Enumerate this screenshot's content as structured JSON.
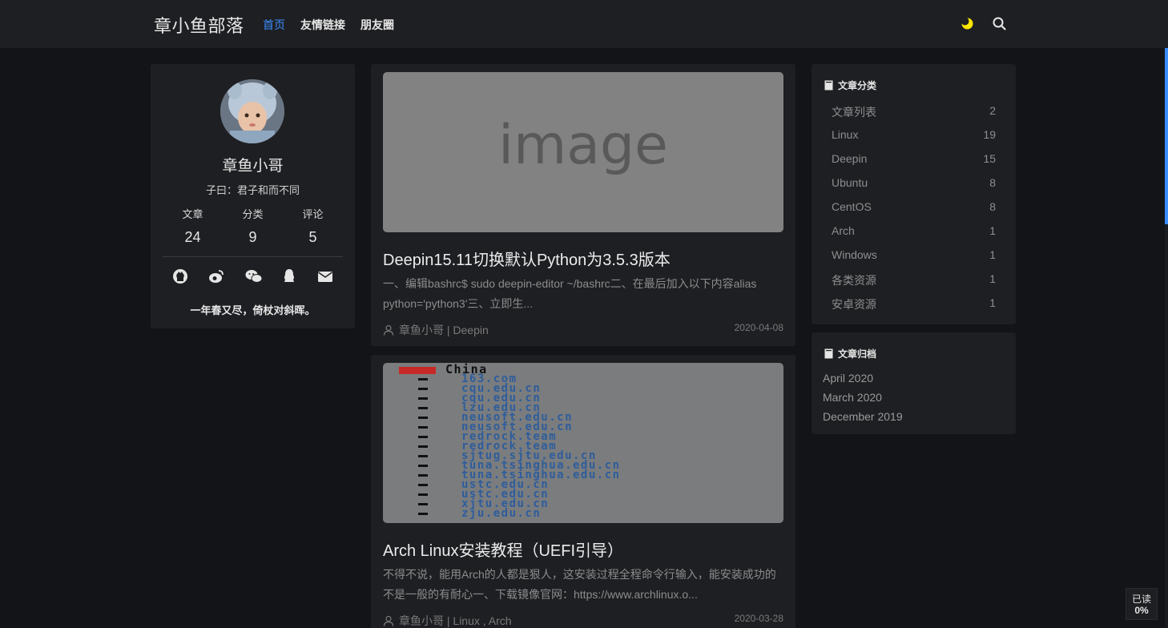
{
  "header": {
    "brand": "章小鱼部落",
    "nav": [
      {
        "label": "首页",
        "active": true
      },
      {
        "label": "友情链接",
        "active": false
      },
      {
        "label": "朋友圈",
        "active": false
      }
    ],
    "icons": [
      "moon-icon",
      "search-icon"
    ],
    "accent_color": "#3b8cff",
    "moon_color": "#ffe600"
  },
  "profile": {
    "name": "章鱼小哥",
    "motto": "子曰：君子和而不同",
    "stats": [
      {
        "label": "文章",
        "value": "24"
      },
      {
        "label": "分类",
        "value": "9"
      },
      {
        "label": "评论",
        "value": "5"
      }
    ],
    "socials": [
      "github-icon",
      "weibo-icon",
      "wechat-icon",
      "qq-icon",
      "email-icon"
    ],
    "quote": "一年春又尽，倚杖对斜晖。"
  },
  "posts": [
    {
      "cover_text": "image",
      "title": "Deepin15.11切换默认Python为3.5.3版本",
      "excerpt": "一、编辑bashrc$ sudo deepin-editor ~/bashrc二、在最后加入以下内容alias python='python3'三、立即生...",
      "meta": "章鱼小哥 | Deepin",
      "date": "2020-04-08"
    },
    {
      "cover_country": "China",
      "cover_mirrors": [
        "163.com",
        "cqu.edu.cn",
        "cqu.edu.cn",
        "lzu.edu.cn",
        "neusoft.edu.cn",
        "neusoft.edu.cn",
        "redrock.team",
        "redrock.team",
        "sjtug.sjtu.edu.cn",
        "tuna.tsinghua.edu.cn",
        "tuna.tsinghua.edu.cn",
        "ustc.edu.cn",
        "ustc.edu.cn",
        "xjtu.edu.cn",
        "zju.edu.cn"
      ],
      "title": "Arch Linux安装教程（UEFI引导）",
      "excerpt": "不得不说，能用Arch的人都是狠人，这安装过程全程命令行输入，能安装成功的不是一般的有耐心一、下载镜像官网：https://www.archlinux.o...",
      "meta": "章鱼小哥 | Linux , Arch",
      "date": "2020-03-28"
    }
  ],
  "categories": {
    "title": "文章分类",
    "items": [
      {
        "name": "文章列表",
        "count": "2"
      },
      {
        "name": "Linux",
        "count": "19"
      },
      {
        "name": "Deepin",
        "count": "15"
      },
      {
        "name": "Ubuntu",
        "count": "8"
      },
      {
        "name": "CentOS",
        "count": "8"
      },
      {
        "name": "Arch",
        "count": "1"
      },
      {
        "name": "Windows",
        "count": "1"
      },
      {
        "name": "各类资源",
        "count": "1"
      },
      {
        "name": "安卓资源",
        "count": "1"
      }
    ]
  },
  "archives": {
    "title": "文章归档",
    "items": [
      "April 2020",
      "March 2020",
      "December 2019"
    ]
  },
  "read_badge": {
    "label": "已读",
    "value": "0%"
  }
}
